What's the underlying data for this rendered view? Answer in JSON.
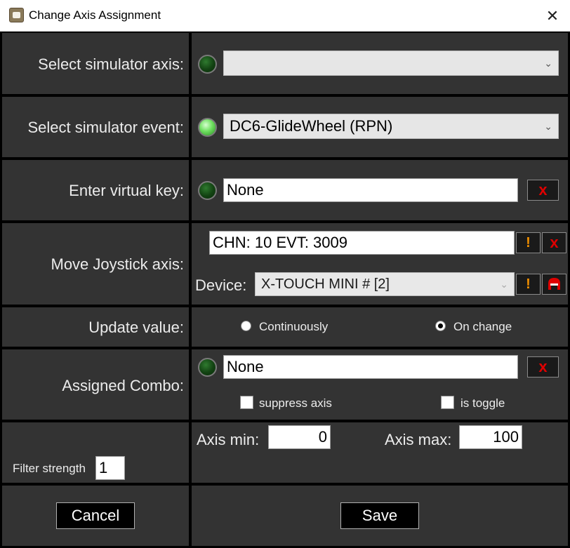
{
  "window": {
    "title": "Change Axis Assignment",
    "close_glyph": "✕",
    "icon": "app-joystick-icon"
  },
  "colors": {
    "panel_bg": "#333333",
    "separator": "#000000",
    "led_on": "#6fe060",
    "led_off": "#124212",
    "clear_button_x": "#e00000",
    "warning_mark": "#f29000"
  },
  "sim_axis": {
    "label": "Select simulator axis:",
    "selected": "",
    "led_state": "off"
  },
  "sim_event": {
    "label": "Select simulator event:",
    "selected": "DC6-GlideWheel (RPN)",
    "led_state": "on"
  },
  "virtual_key": {
    "label": "Enter virtual key:",
    "value": "None",
    "led_state": "off",
    "clear_glyph": "x"
  },
  "joystick": {
    "label": "Move Joystick axis:",
    "value": "CHN: 10 EVT: 3009",
    "warn_glyph": "!",
    "clear_glyph": "x",
    "device_label": "Device:",
    "device_value": "X-TOUCH MINI # [2]",
    "device_warn_glyph": "!",
    "helmet_icon": "helmet-icon"
  },
  "update": {
    "label": "Update value:",
    "option_continuous": "Continuously",
    "option_on_change": "On change",
    "selected": "On change"
  },
  "combo": {
    "label": "Assigned Combo:",
    "value": "None",
    "led_state": "off",
    "clear_glyph": "x",
    "suppress_label": "suppress axis",
    "suppress_checked": false,
    "toggle_label": "is toggle",
    "toggle_checked": false
  },
  "filter": {
    "label": "Filter strength",
    "value": "1",
    "axis_min_label": "Axis min:",
    "axis_min_value": "0",
    "axis_max_label": "Axis max:",
    "axis_max_value": "100"
  },
  "buttons": {
    "cancel": "Cancel",
    "save": "Save"
  },
  "chevron_glyph": "⌄"
}
